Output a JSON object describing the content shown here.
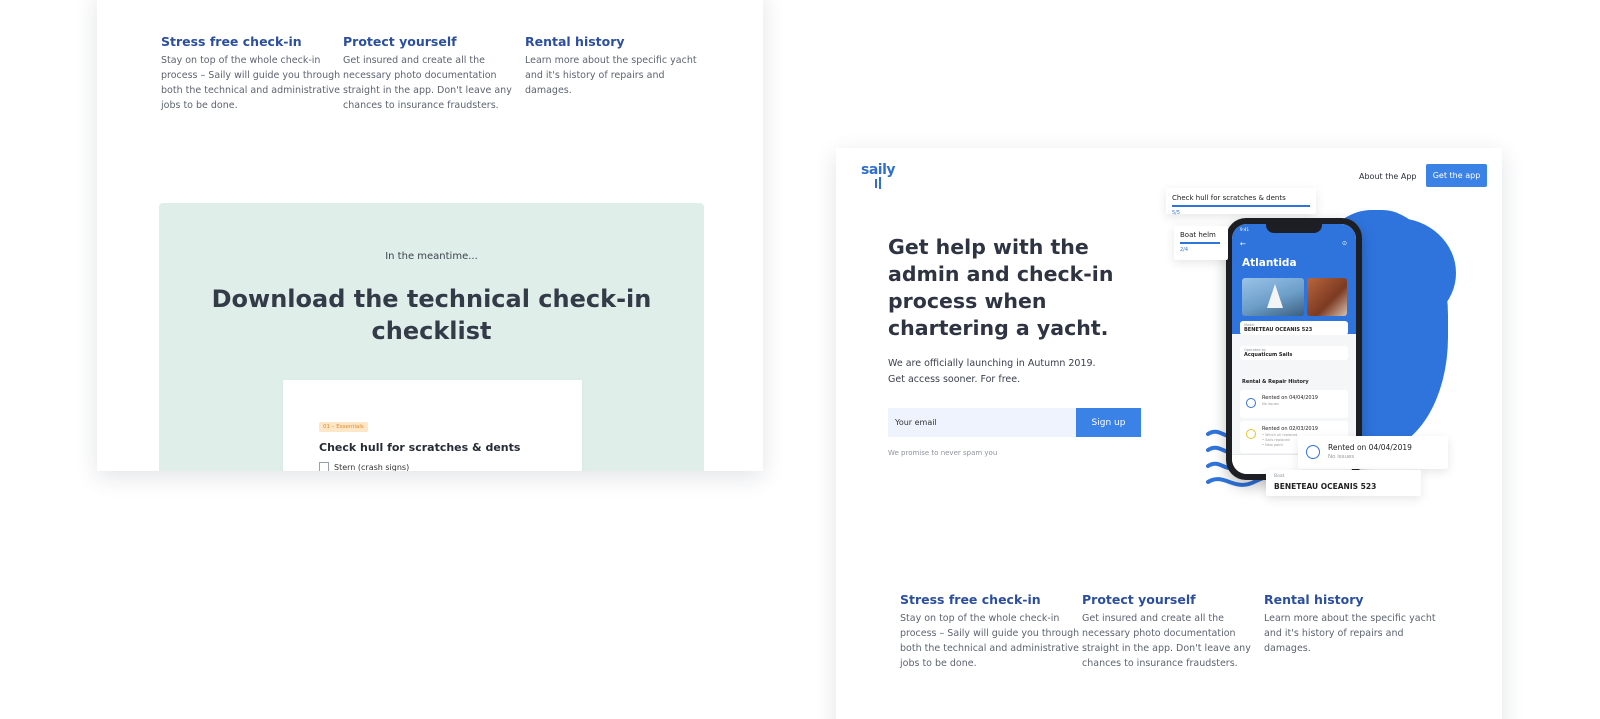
{
  "features": [
    {
      "title": "Stress free check-in",
      "text": "Stay on top of the whole check-in process – Saily will guide you through both the technical and administrative jobs to be done."
    },
    {
      "title": "Protect yourself",
      "text": "Get insured and create all the necessary photo documentation straight in the app. Don't leave any chances to insurance fraudsters."
    },
    {
      "title": "Rental history",
      "text": "Learn more about the specific yacht and it's history of repairs and damages."
    }
  ],
  "download": {
    "pre": "In the meantime...",
    "title": "Download the technical check-in checklist",
    "checklist": {
      "tag": "01 – Essentials",
      "title": "Check hull for scratches & dents",
      "item": "Stern (crash signs)"
    }
  },
  "header": {
    "logo": "saily",
    "nav_link": "About the App",
    "cta": "Get the app"
  },
  "hero": {
    "title": "Get help with the admin and check-in process when chartering a yacht.",
    "sub_line1": "We are officially launching in Autumn 2019.",
    "sub_line2": "Get access sooner. For free.",
    "email_placeholder": "Your email",
    "signup": "Sign up",
    "promise": "We promise to never spam you"
  },
  "illustration": {
    "card1_title": "Check hull for scratches & dents",
    "card1_count": "5/5",
    "card2_title": "Boat helm",
    "card2_count": "2/4",
    "phone": {
      "time": "9:41",
      "back_icon": "←",
      "pin_icon": "⊙",
      "yacht_name": "Atlantida",
      "model_label": "Model",
      "model": "BENETEAU OCEANIS 523",
      "operator_label": "Operated by",
      "operator": "Acquaticum Sails",
      "history_title": "Rental & Repair History",
      "row1_title": "Rented on 04/04/2019",
      "row1_sub": "No issues",
      "row2_title": "Rented on 02/03/2019",
      "row2_sub": "• Winch oil replaced\n• Sails replaced\n• New paint"
    },
    "card3_title": "Rented on 04/04/2019",
    "card3_sub": "No issues",
    "card4_label": "Boat",
    "card4_value": "BENETEAU OCEANIS 523"
  },
  "colors": {
    "accent": "#3b82e6",
    "feature_title": "#2b4f9e",
    "panel": "#dfeee8"
  }
}
